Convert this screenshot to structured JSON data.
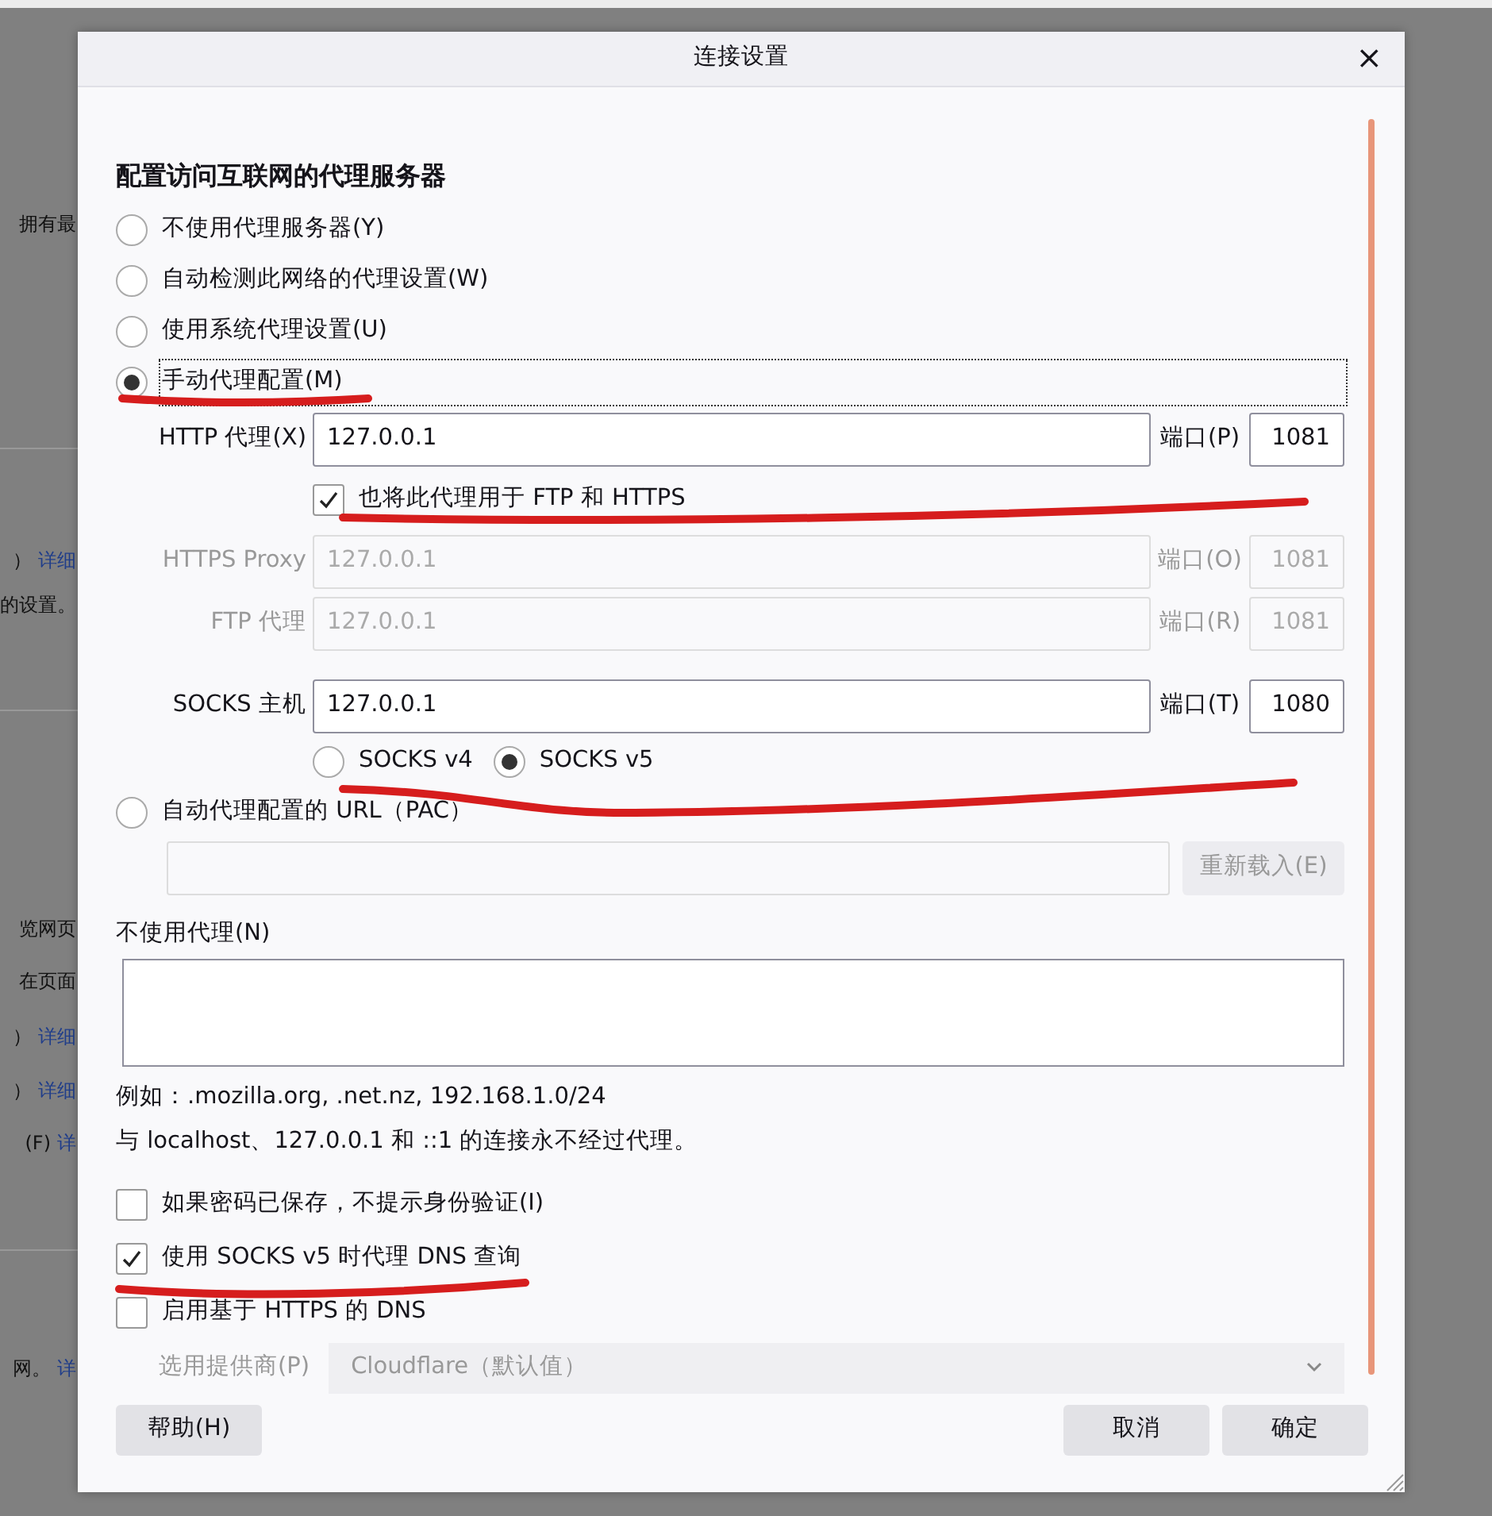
{
  "backdrop": {
    "lines": [
      {
        "parts": [
          {
            "text": "拥有最",
            "kind": "text"
          }
        ]
      },
      {
        "parts": [
          {
            "text": "）",
            "kind": "text"
          },
          {
            "text": "详细",
            "kind": "link"
          }
        ]
      },
      {
        "parts": [
          {
            "text": "的设置。",
            "kind": "text"
          }
        ]
      },
      {
        "parts": [
          {
            "text": "览网页",
            "kind": "text"
          }
        ]
      },
      {
        "parts": [
          {
            "text": "在页面",
            "kind": "text"
          }
        ]
      },
      {
        "parts": [
          {
            "text": "）",
            "kind": "text"
          },
          {
            "text": "详细",
            "kind": "link"
          }
        ]
      },
      {
        "parts": [
          {
            "text": "）",
            "kind": "text"
          },
          {
            "text": "详细",
            "kind": "link"
          }
        ]
      },
      {
        "parts": [
          {
            "text": "(F)",
            "kind": "text"
          },
          {
            "text": "详",
            "kind": "link"
          }
        ]
      },
      {
        "parts": [
          {
            "text": "网。",
            "kind": "text"
          },
          {
            "text": "详",
            "kind": "link"
          }
        ]
      }
    ]
  },
  "dialog": {
    "title": "连接设置",
    "close": "×"
  },
  "heading": "配置访问互联网的代理服务器",
  "proxy_modes": [
    {
      "label": "不使用代理服务器(Y)",
      "selected": false,
      "focused": false
    },
    {
      "label": "自动检测此网络的代理设置(W)",
      "selected": false,
      "focused": false
    },
    {
      "label": "使用系统代理设置(U)",
      "selected": false,
      "focused": false
    },
    {
      "label": "手动代理配置(M)",
      "selected": true,
      "focused": true
    }
  ],
  "manual": {
    "http": {
      "label": "HTTP 代理(X)",
      "value": "127.0.0.1",
      "port_label": "端口(P)",
      "port": "1081",
      "disabled": false
    },
    "also_use": {
      "label": "也将此代理用于 FTP 和 HTTPS",
      "checked": true
    },
    "https": {
      "label": "HTTPS Proxy",
      "value": "127.0.0.1",
      "port_label": "端口(O)",
      "port": "1081",
      "disabled": true
    },
    "ftp": {
      "label": "FTP 代理",
      "value": "127.0.0.1",
      "port_label": "端口(R)",
      "port": "1081",
      "disabled": true
    },
    "socks": {
      "label": "SOCKS 主机",
      "value": "127.0.0.1",
      "port_label": "端口(T)",
      "port": "1080",
      "disabled": false
    },
    "socks_versions": [
      {
        "label": "SOCKS v4",
        "selected": false
      },
      {
        "label": "SOCKS v5",
        "selected": true
      }
    ]
  },
  "pac": {
    "label": "自动代理配置的 URL（PAC）",
    "selected": false,
    "reload_button": "重新载入(E)",
    "disabled": true
  },
  "no_proxy": {
    "label": "不使用代理(N)"
  },
  "hints": [
    "例如：.mozilla.org, .net.nz, 192.168.1.0/24",
    "与 localhost、127.0.0.1 和 ::1 的连接永不经过代理。"
  ],
  "options": [
    {
      "label": "如果密码已保存，不提示身份验证(I)",
      "checked": false
    },
    {
      "label": "使用 SOCKS v5 时代理 DNS 查询",
      "checked": true
    },
    {
      "label": "启用基于 HTTPS 的 DNS",
      "checked": false
    }
  ],
  "provider": {
    "label": "选用提供商(P)",
    "value": "Cloudflare（默认值）",
    "disabled": true
  },
  "buttons": {
    "help": "帮助(H)",
    "cancel": "取消",
    "ok": "确定"
  }
}
